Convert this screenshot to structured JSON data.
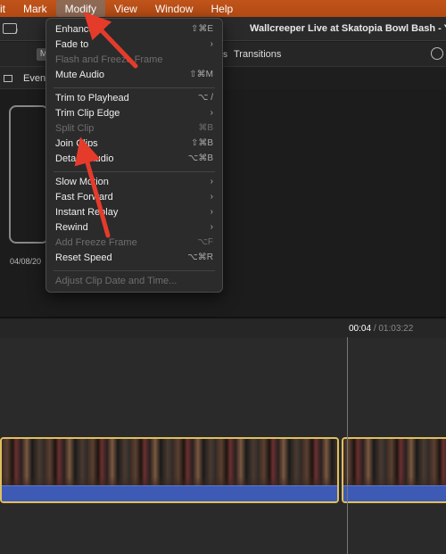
{
  "menubar": {
    "items": [
      {
        "label": "it"
      },
      {
        "label": "Mark"
      },
      {
        "label": "Modify"
      },
      {
        "label": "View"
      },
      {
        "label": "Window"
      },
      {
        "label": "Help"
      }
    ]
  },
  "window": {
    "title": "Wallcreeper Live at Skatopia Bowl Bash - Your Day"
  },
  "toolbar": {
    "tab_m": "M",
    "tab_s": "s",
    "tab_transitions": "Transitions"
  },
  "browser": {
    "events_label": "Events",
    "clip_date": "04/08/20"
  },
  "timeline": {
    "current_time": "00:04",
    "separator": "/",
    "total_time": "01:03:22"
  },
  "modify_menu": {
    "items": [
      {
        "label": "Enhance",
        "shortcut": "⇧⌘E",
        "enabled": true
      },
      {
        "label": "Fade to",
        "shortcut": "›",
        "enabled": true
      },
      {
        "label": "Flash and Freeze Frame",
        "shortcut": "",
        "enabled": false
      },
      {
        "label": "Mute Audio",
        "shortcut": "⇧⌘M",
        "enabled": true
      },
      {
        "label": "Trim to Playhead",
        "shortcut": "⌥ /",
        "enabled": true
      },
      {
        "label": "Trim Clip Edge",
        "shortcut": "›",
        "enabled": true
      },
      {
        "label": "Split Clip",
        "shortcut": "⌘B",
        "enabled": false
      },
      {
        "label": "Join Clips",
        "shortcut": "⇧⌘B",
        "enabled": true
      },
      {
        "label": "Detach Audio",
        "shortcut": "⌥⌘B",
        "enabled": true
      },
      {
        "label": "Slow Motion",
        "shortcut": "›",
        "enabled": true
      },
      {
        "label": "Fast Forward",
        "shortcut": "›",
        "enabled": true
      },
      {
        "label": "Instant Replay",
        "shortcut": "›",
        "enabled": true
      },
      {
        "label": "Rewind",
        "shortcut": "›",
        "enabled": true
      },
      {
        "label": "Add Freeze Frame",
        "shortcut": "⌥F",
        "enabled": false
      },
      {
        "label": "Reset Speed",
        "shortcut": "⌥⌘R",
        "enabled": true
      },
      {
        "label": "Adjust Clip Date and Time...",
        "shortcut": "",
        "enabled": false
      }
    ]
  },
  "colors": {
    "menubar": "#b24a13",
    "annotation_arrow": "#e53b2b",
    "clip_border": "#e0c060",
    "audio_track": "#3d5bb5"
  }
}
